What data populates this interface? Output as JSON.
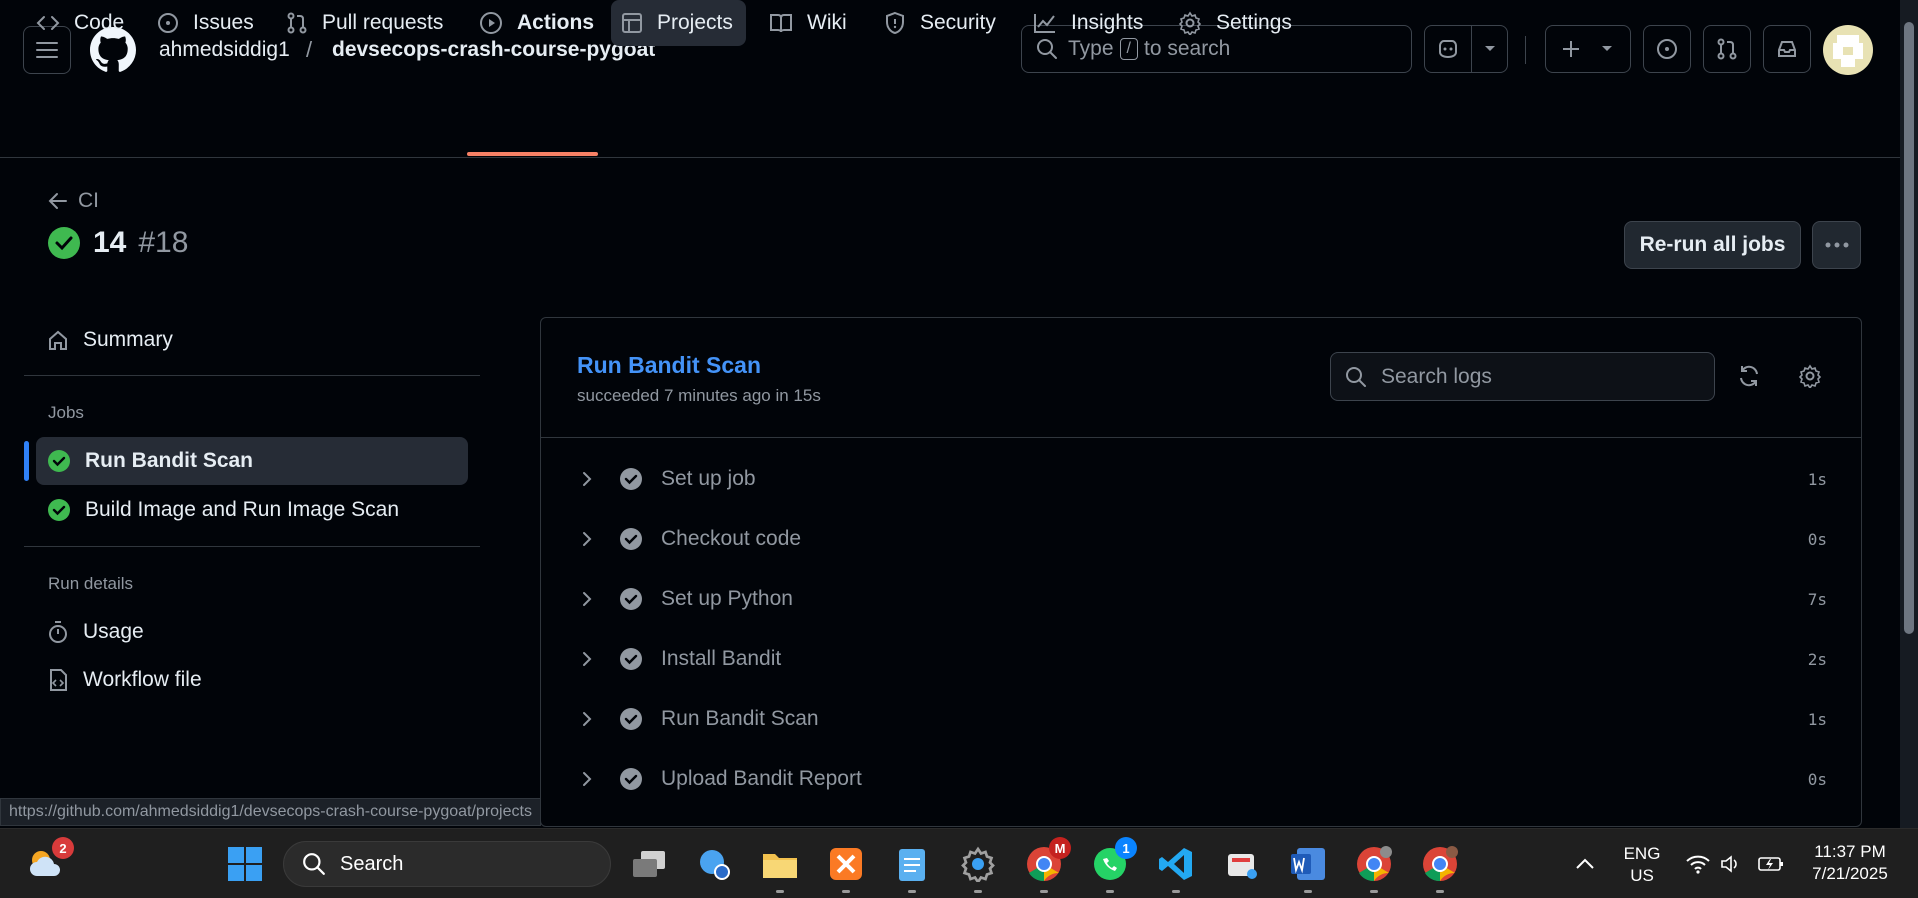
{
  "header": {
    "owner": "ahmedsiddig1",
    "separator": "/",
    "repo": "devsecops-crash-course-pygoat",
    "search_prefix": "Type",
    "search_key": "/",
    "search_suffix": "to search"
  },
  "tabs": [
    {
      "label": "Code",
      "icon": "code-icon"
    },
    {
      "label": "Issues",
      "icon": "issue-icon"
    },
    {
      "label": "Pull requests",
      "icon": "pull-request-icon"
    },
    {
      "label": "Actions",
      "icon": "play-icon",
      "active": true
    },
    {
      "label": "Projects",
      "icon": "table-icon"
    },
    {
      "label": "Wiki",
      "icon": "book-icon"
    },
    {
      "label": "Security",
      "icon": "shield-icon"
    },
    {
      "label": "Insights",
      "icon": "graph-icon"
    },
    {
      "label": "Settings",
      "icon": "gear-icon"
    }
  ],
  "run": {
    "back_label": "CI",
    "number": "14",
    "id": "#18",
    "rerun_label": "Re-run all jobs"
  },
  "sidebar": {
    "summary_label": "Summary",
    "jobs_heading": "Jobs",
    "jobs": [
      {
        "label": "Run Bandit Scan",
        "status": "success",
        "active": true
      },
      {
        "label": "Build Image and Run Image Scan",
        "status": "success"
      }
    ],
    "run_details_heading": "Run details",
    "details": [
      {
        "label": "Usage",
        "icon": "stopwatch-icon"
      },
      {
        "label": "Workflow file",
        "icon": "file-code-icon"
      }
    ]
  },
  "job": {
    "title": "Run Bandit Scan",
    "subtitle": "succeeded 7 minutes ago in 15s",
    "search_placeholder": "Search logs",
    "steps": [
      {
        "name": "Set up job",
        "duration": "1s"
      },
      {
        "name": "Checkout code",
        "duration": "0s"
      },
      {
        "name": "Set up Python",
        "duration": "7s"
      },
      {
        "name": "Install Bandit",
        "duration": "2s"
      },
      {
        "name": "Run Bandit Scan",
        "duration": "1s"
      },
      {
        "name": "Upload Bandit Report",
        "duration": "0s"
      }
    ]
  },
  "status_url": "https://github.com/ahmedsiddig1/devsecops-crash-course-pygoat/projects",
  "taskbar": {
    "weather_badge": "2",
    "search_label": "Search",
    "gmail_badge": "M",
    "whatsapp_badge": "1",
    "lang_line1": "ENG",
    "lang_line2": "US",
    "time": "11:37 PM",
    "date": "7/21/2025"
  },
  "colors": {
    "success": "#3fb950",
    "link": "#4493f8",
    "accent_underline": "#f78166",
    "background": "#010409"
  }
}
